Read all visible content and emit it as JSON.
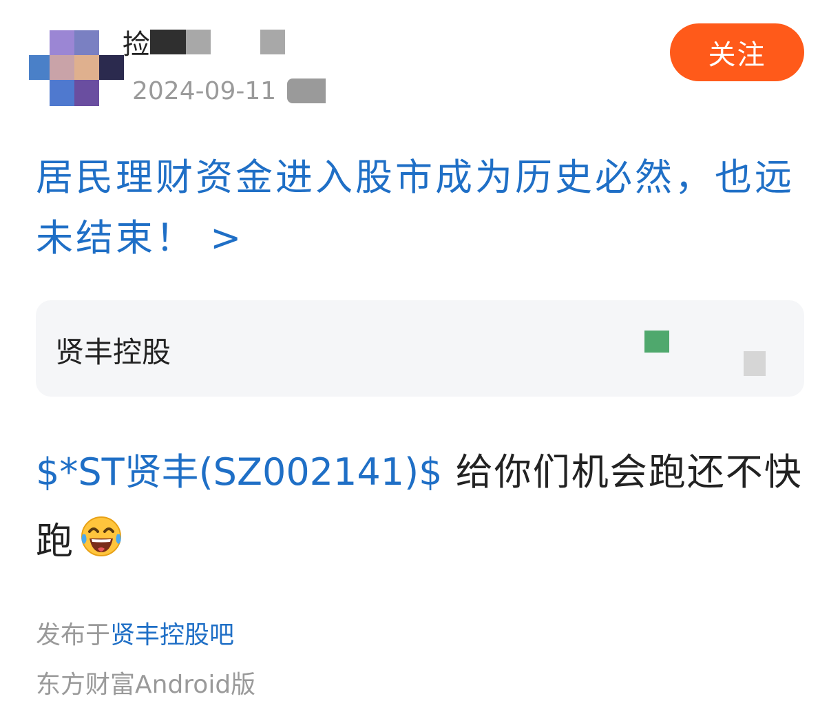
{
  "header": {
    "username_visible": "捡",
    "post_date": "2024-09-11",
    "follow_label": "关注"
  },
  "topic": {
    "title": "居民理财资金进入股市成为历史必然，也远未结束！ >"
  },
  "stock_card": {
    "name": "贤丰控股"
  },
  "post": {
    "stock_tag": "$*ST贤丰(SZ002141)$",
    "text": " 给你们机会跑还不快跑"
  },
  "footer": {
    "published_prefix": "发布于",
    "forum_name": "贤丰控股吧",
    "client": "东方财富Android版"
  },
  "colors": {
    "link_blue": "#1f6fc6",
    "follow_orange": "#ff5a1a",
    "muted_gray": "#9a9a9a",
    "card_bg": "#f5f6f8"
  },
  "icons": [
    "avatar-pixelated",
    "tears-of-joy-emoji"
  ]
}
